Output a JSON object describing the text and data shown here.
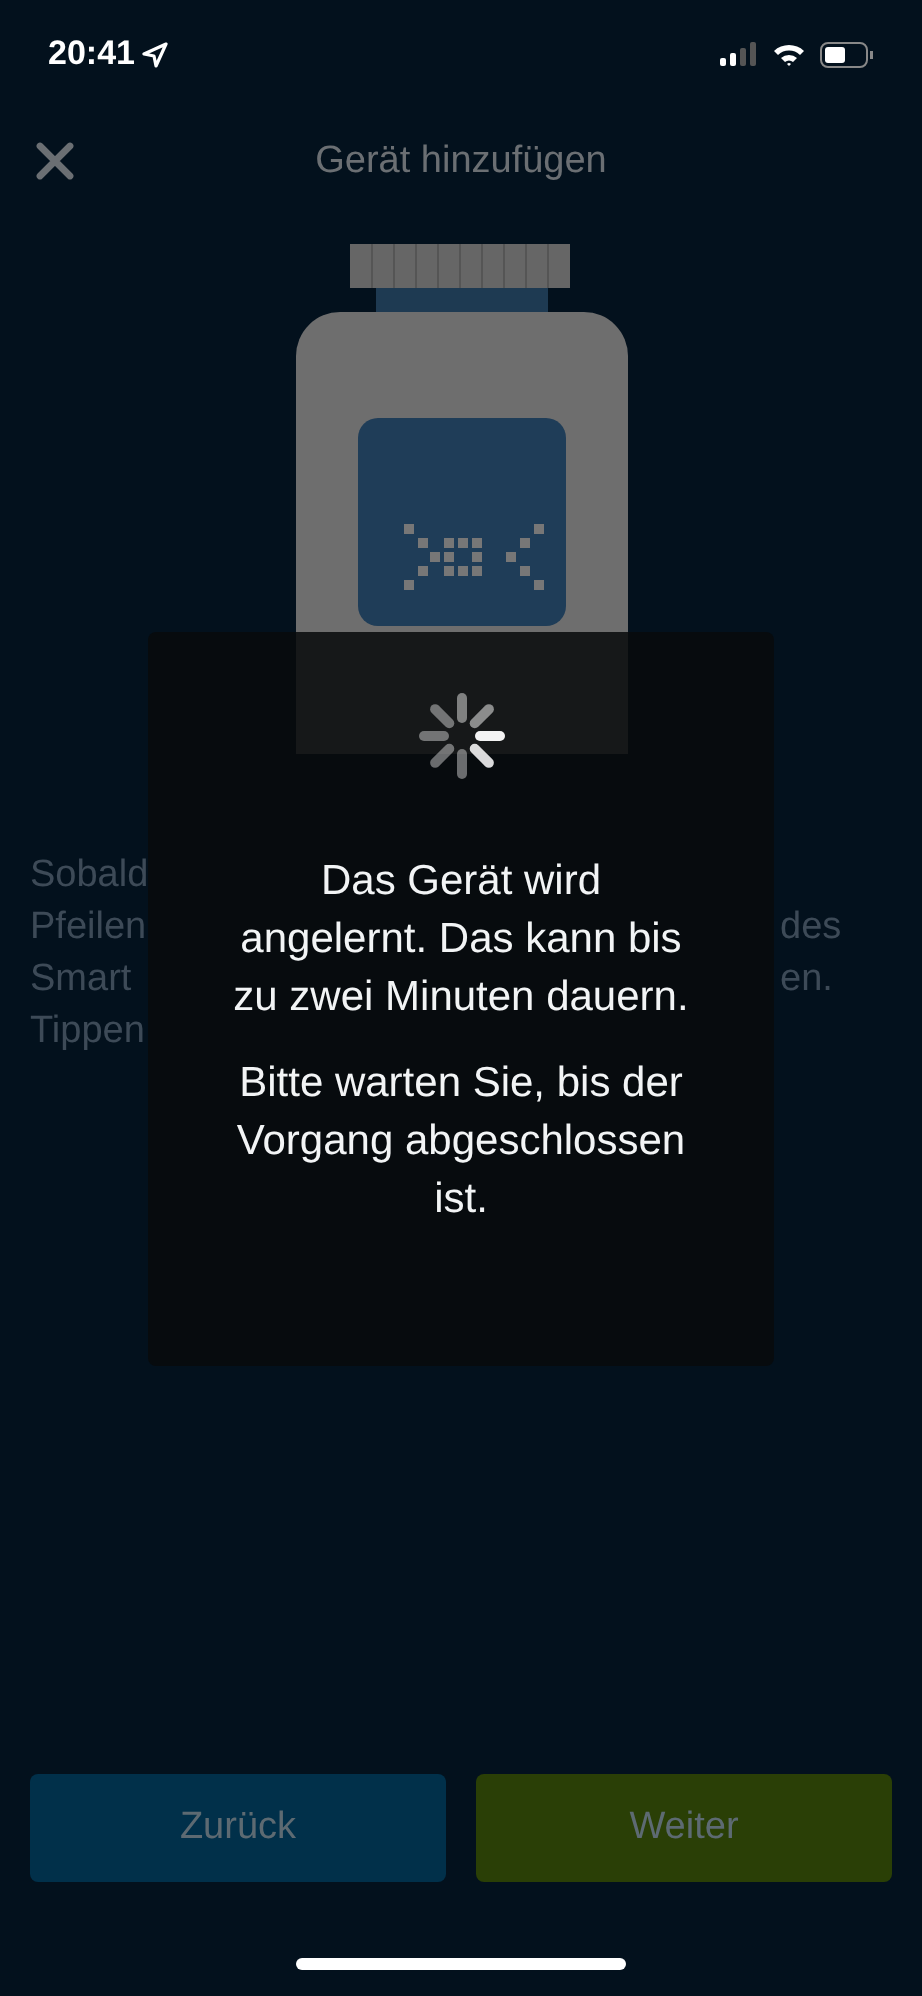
{
  "status_bar": {
    "time": "20:41"
  },
  "header": {
    "title": "Gerät hinzufügen"
  },
  "background_text": [
    {
      "left": "Sobald"
    },
    {
      "left": "Pfeilen",
      "right": "des"
    },
    {
      "left": "Smart",
      "right": "en."
    },
    {
      "left": "Tippen"
    }
  ],
  "dialog": {
    "paragraphs": [
      "Das Gerät wird angelernt. Das kann bis zu zwei Minuten dauern.",
      "Bitte warten Sie, bis der Vorgang abgeschlossen ist."
    ]
  },
  "buttons": [
    {
      "label": "Zurück",
      "kind": "back"
    },
    {
      "label": "Weiter",
      "kind": "next"
    }
  ]
}
